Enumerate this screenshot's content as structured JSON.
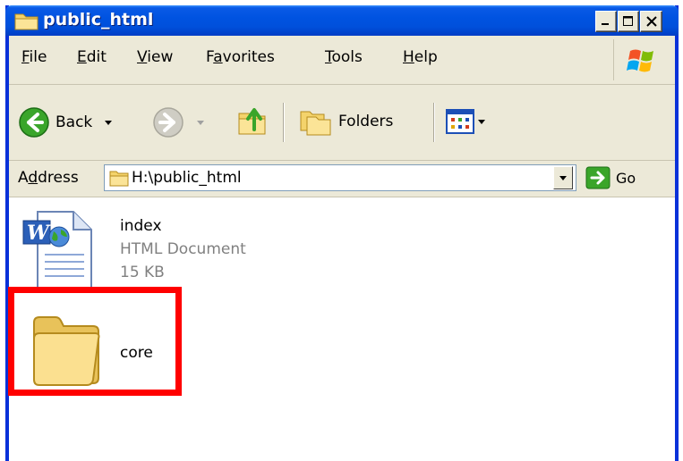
{
  "window": {
    "title": "public_html"
  },
  "title_buttons": {
    "minimize": "minimize",
    "maximize": "maximize",
    "close": "close"
  },
  "menu": {
    "items": [
      {
        "pre": "",
        "ul": "F",
        "post": "ile"
      },
      {
        "pre": "",
        "ul": "E",
        "post": "dit"
      },
      {
        "pre": "",
        "ul": "V",
        "post": "iew"
      },
      {
        "pre": "F",
        "ul": "a",
        "post": "vorites"
      },
      {
        "pre": "",
        "ul": "T",
        "post": "ools"
      },
      {
        "pre": "",
        "ul": "H",
        "post": "elp"
      }
    ]
  },
  "toolbar": {
    "back_label": "Back",
    "folders_label": "Folders"
  },
  "address": {
    "label_pre": "A",
    "label_ul": "d",
    "label_post": "dress",
    "value": "H:\\public_html",
    "go_label": "Go"
  },
  "files": [
    {
      "name": "index",
      "type": "HTML Document",
      "size": "15 KB"
    },
    {
      "name": "core"
    }
  ],
  "colors": {
    "highlight": "#ff0000",
    "titlebar": "#0053e1"
  }
}
